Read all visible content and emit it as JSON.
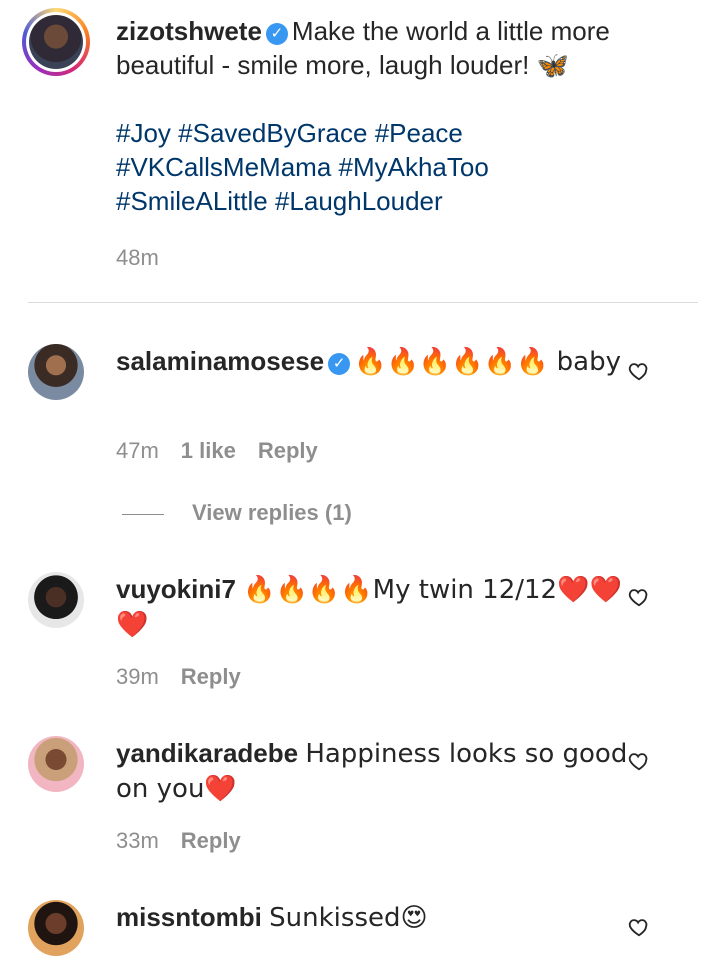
{
  "caption": {
    "username": "zizotshwete",
    "text": "Make the world a little more beautiful - smile more, laugh louder! 🦋",
    "hashtags_line1": "#Joy #SavedByGrace #Peace",
    "hashtags_line2": "#VKCallsMeMama #MyAkhaToo",
    "hashtags_line3": "#SmileALittle #LaughLouder",
    "time": "48m"
  },
  "comments": [
    {
      "username": "salaminamosese",
      "text": "🔥🔥🔥🔥🔥🔥 baby",
      "time": "47m",
      "likes": "1 like",
      "reply_label": "Reply",
      "view_replies": "View replies (1)"
    },
    {
      "username": "vuyokini7",
      "text": "🔥🔥🔥🔥My twin 12/12❤️❤️❤️",
      "time": "39m",
      "reply_label": "Reply"
    },
    {
      "username": "yandikaradebe",
      "text": "Happiness looks so good on you❤️",
      "time": "33m",
      "reply_label": "Reply"
    },
    {
      "username": "missntombi",
      "text": "Sunkissed😍"
    }
  ],
  "icons": {
    "verified": "verified-badge-icon",
    "like": "heart-outline-icon"
  },
  "colors": {
    "hashtag": "#00376b",
    "verified": "#3897f0",
    "meta": "#8e8e8e"
  }
}
